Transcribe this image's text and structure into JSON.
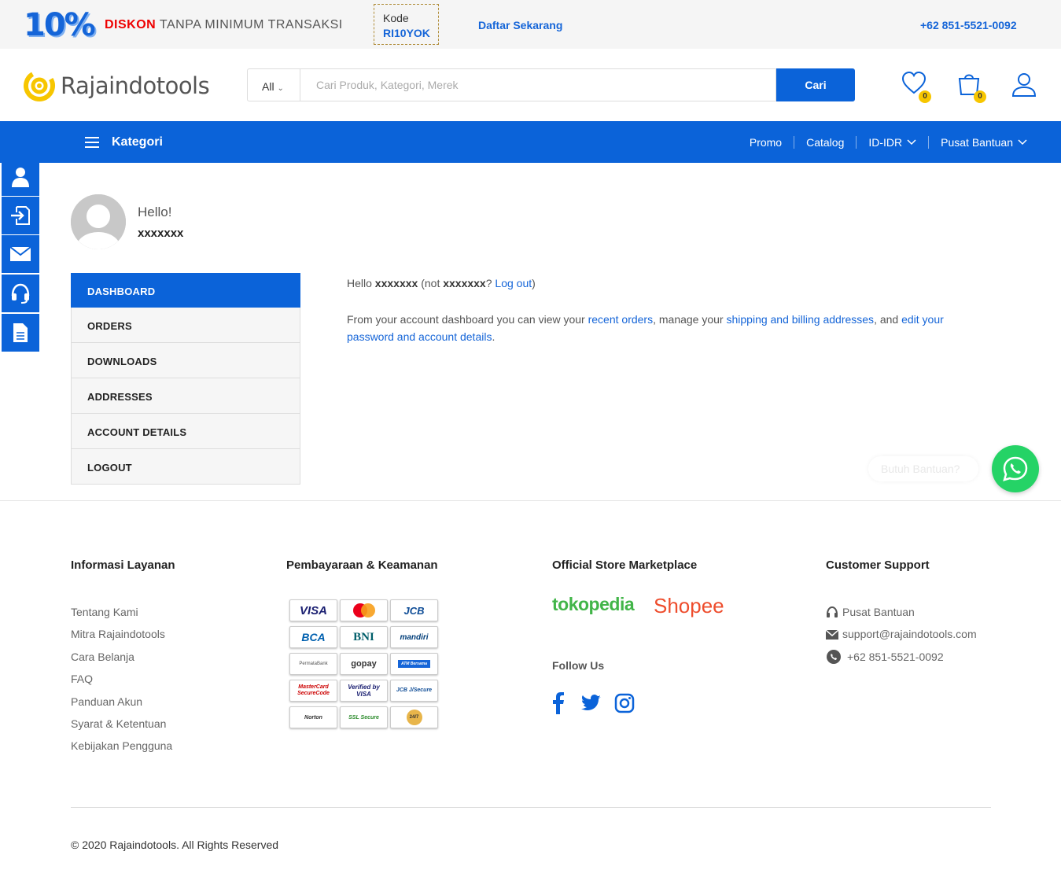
{
  "promo": {
    "percent": "10%",
    "diskon": "DISKON",
    "diskon_rest": "TANPA MINIMUM TRANSAKSI",
    "kode_label": "Kode",
    "kode_value": "RI10YOK",
    "daftar": "Daftar Sekarang",
    "phone": "+62 851-5521-0092"
  },
  "header": {
    "logo_text": "Rajaindotools",
    "search_category": "All",
    "search_placeholder": "Cari Produk, Kategori, Merek",
    "search_button": "Cari",
    "wishlist_count": "0",
    "cart_count": "0"
  },
  "nav": {
    "kategori": "Kategori",
    "items": [
      "Promo",
      "Catalog",
      "ID-IDR",
      "Pusat Bantuan"
    ]
  },
  "sidebar_icons": [
    "user-icon",
    "login-icon",
    "mail-icon",
    "headset-icon",
    "document-icon"
  ],
  "account": {
    "greeting": "Hello!",
    "username": "xxxxxxx",
    "menu": [
      "DASHBOARD",
      "ORDERS",
      "DOWNLOADS",
      "ADDRESSES",
      "ACCOUNT DETAILS",
      "LOGOUT"
    ],
    "active_menu": "DASHBOARD",
    "hello_prefix": "Hello",
    "hello_name": "xxxxxxx",
    "hello_not": "(not",
    "hello_name2": "xxxxxxx",
    "hello_q": "?",
    "logout_link": "Log out",
    "hello_close": ")",
    "dash_text1": "From your account dashboard you can view your",
    "recent_orders": "recent orders",
    "dash_text2": ", manage your",
    "addresses_link": "shipping and billing addresses",
    "dash_text3": ", and",
    "edit_link": "edit your password and account details",
    "dash_text4": "."
  },
  "whatsapp": {
    "bubble": "Butuh Bantuan?"
  },
  "footer": {
    "col1": {
      "title": "Informasi Layanan",
      "links": [
        "Tentang Kami",
        "Mitra Rajaindotools",
        "Cara Belanja",
        "FAQ",
        "Panduan Akun",
        "Syarat & Ketentuan",
        "Kebijakan Pengguna"
      ]
    },
    "col2": {
      "title": "Pembayaraan & Keamanan",
      "cards": [
        "VISA",
        "MasterCard",
        "JCB",
        "BCA",
        "BNI",
        "mandiri",
        "PermataBank",
        "gopay",
        "ATM Bersama",
        "MasterCard SecureCode",
        "Verified by VISA",
        "JCB J/Secure",
        "Norton",
        "SSL Secure",
        "24/7"
      ]
    },
    "col3": {
      "title": "Official Store Marketplace",
      "tokopedia": "tokopedia",
      "shopee": "Shopee",
      "follow": "Follow Us"
    },
    "col4": {
      "title": "Customer Support",
      "items": [
        "Pusat Bantuan",
        "support@rajaindotools.com",
        "+62 851-5521-0092"
      ]
    },
    "copyright": "© 2020 Rajaindotools. All Rights Reserved"
  },
  "colors": {
    "primary": "#0b63d9",
    "accent_yellow": "#f7c600",
    "whatsapp": "#25d366"
  }
}
